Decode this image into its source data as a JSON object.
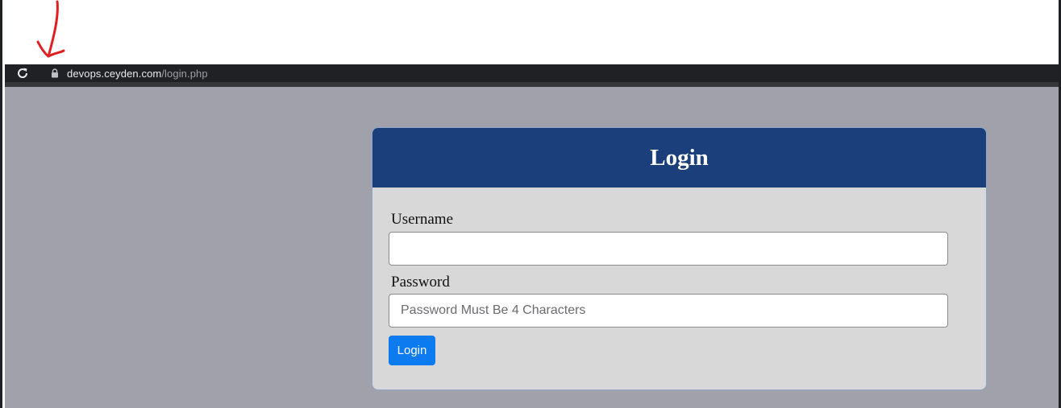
{
  "annotation": {
    "color": "#e02020",
    "icon": "hand-drawn-arrow-down-icon"
  },
  "browser": {
    "reload_icon": "reload-icon",
    "lock_icon": "lock-icon",
    "url_host": "devops.ceyden.com",
    "url_path": "/login.php"
  },
  "login_card": {
    "title": "Login",
    "username_label": "Username",
    "username_value": "",
    "password_label": "Password",
    "password_placeholder": "Password Must Be 4 Characters",
    "submit_label": "Login"
  },
  "colors": {
    "header": "#1b3f7a",
    "button": "#0d7bf0",
    "page_bg": "#a0a1ab",
    "card_bg": "#d9d8d9"
  }
}
